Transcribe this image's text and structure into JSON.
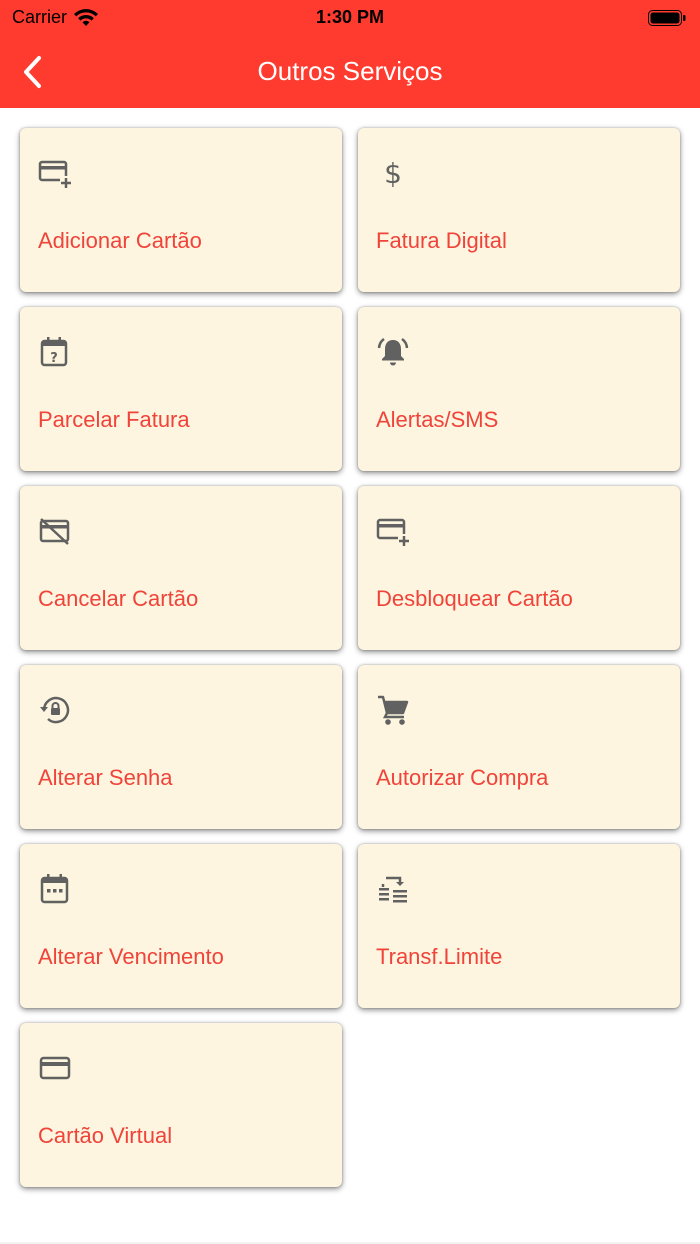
{
  "status_bar": {
    "carrier": "Carrier",
    "time": "1:30 PM"
  },
  "nav": {
    "title": "Outros Serviços",
    "back_icon": "chevron-left-icon"
  },
  "colors": {
    "header": "#ff3b30",
    "card_background": "#fdf5df",
    "label": "#f0433a",
    "icon": "#616161"
  },
  "services": [
    {
      "label": "Adicionar Cartão",
      "icon": "add-card-icon"
    },
    {
      "label": "Fatura Digital",
      "icon": "dollar-icon"
    },
    {
      "label": "Parcelar Fatura",
      "icon": "calendar-question-icon"
    },
    {
      "label": "Alertas/SMS",
      "icon": "bell-ringing-icon"
    },
    {
      "label": "Cancelar Cartão",
      "icon": "card-off-icon"
    },
    {
      "label": "Desbloquear Cartão",
      "icon": "add-card-icon"
    },
    {
      "label": "Alterar Senha",
      "icon": "lock-reset-icon"
    },
    {
      "label": "Autorizar Compra",
      "icon": "shopping-cart-icon"
    },
    {
      "label": "Alterar Vencimento",
      "icon": "calendar-icon"
    },
    {
      "label": "Transf.Limite",
      "icon": "transfer-icon"
    },
    {
      "label": "Cartão Virtual",
      "icon": "credit-card-icon"
    }
  ]
}
